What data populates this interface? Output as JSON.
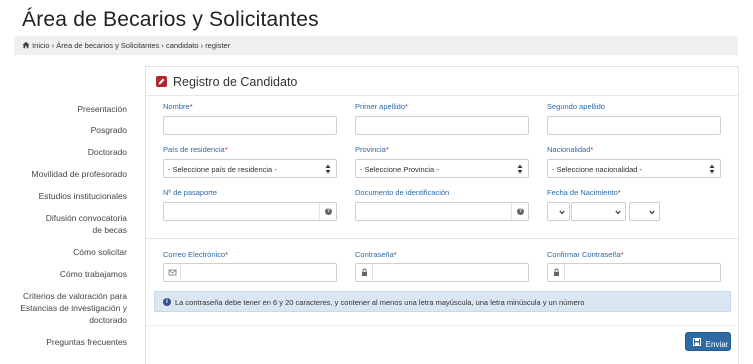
{
  "page": {
    "title": "Área de Becarios y Solicitantes"
  },
  "breadcrumb": {
    "items": [
      "Inicio",
      "Área de becarios y Solicitantes",
      "candidato",
      "register"
    ],
    "separator": "›"
  },
  "sidebar": {
    "items": [
      {
        "label": "Presentación"
      },
      {
        "label": "Posgrado"
      },
      {
        "label": "Doctorado"
      },
      {
        "label": "Movilidad de profesorado"
      },
      {
        "label": "Estudios institucionales"
      },
      {
        "label": "Difusión convocatoria de becas"
      },
      {
        "label": "Cómo solicitar"
      },
      {
        "label": "Cómo trabajamos"
      },
      {
        "label": "Criterios de valoración para Estancias de investigación y doctorado"
      },
      {
        "label": "Preguntas frecuentes"
      }
    ]
  },
  "form": {
    "title": "Registro de Candidato",
    "required_marker": "*",
    "fields": {
      "nombre": {
        "label": "Nombre",
        "required": true,
        "value": ""
      },
      "primer_apellido": {
        "label": "Primer apellido",
        "required": true,
        "value": ""
      },
      "segundo_apellido": {
        "label": "Segundo apellido",
        "required": false,
        "value": ""
      },
      "pais_residencia": {
        "label": "País de residencia",
        "required": true,
        "selected": "- Seleccione país de residencia -"
      },
      "provincia": {
        "label": "Provincia",
        "required": true,
        "selected": "- Seleccione Provincia -"
      },
      "nacionalidad": {
        "label": "Nacionalidad",
        "required": true,
        "selected": "- Seleccione nacionalidad -"
      },
      "pasaporte": {
        "label": "Nº de pasaporte",
        "required": false,
        "value": ""
      },
      "documento": {
        "label": "Documento de identificación",
        "required": false,
        "value": ""
      },
      "fecha_nacimiento": {
        "label": "Fecha de Nacimiento",
        "required": true,
        "day": "",
        "month": "",
        "year": ""
      },
      "correo": {
        "label": "Correo Electrónico",
        "required": true,
        "value": ""
      },
      "contrasena": {
        "label": "Contraseña",
        "required": true,
        "value": ""
      },
      "confirmar_contrasena": {
        "label": "Confirmar Contraseña",
        "required": true,
        "value": ""
      }
    },
    "password_hint": "La contraseña debe tener en 6 y 20 caracteres, y contener al menos una letra mayúscula, una letra minúscula y un número",
    "submit_label": "Enviar"
  },
  "colors": {
    "label_blue": "#2a6aa6",
    "required_red": "#c0282d",
    "info_bg": "#dbe6f3",
    "button_blue": "#2f6aa3",
    "edit_icon_red": "#b0272d"
  },
  "icons": {
    "home": "home-icon",
    "edit": "edit-icon",
    "question": "question-icon",
    "email": "envelope-icon",
    "lock": "lock-icon",
    "info": "info-icon",
    "save": "save-icon",
    "select_arrows": "sort-arrows-icon"
  }
}
